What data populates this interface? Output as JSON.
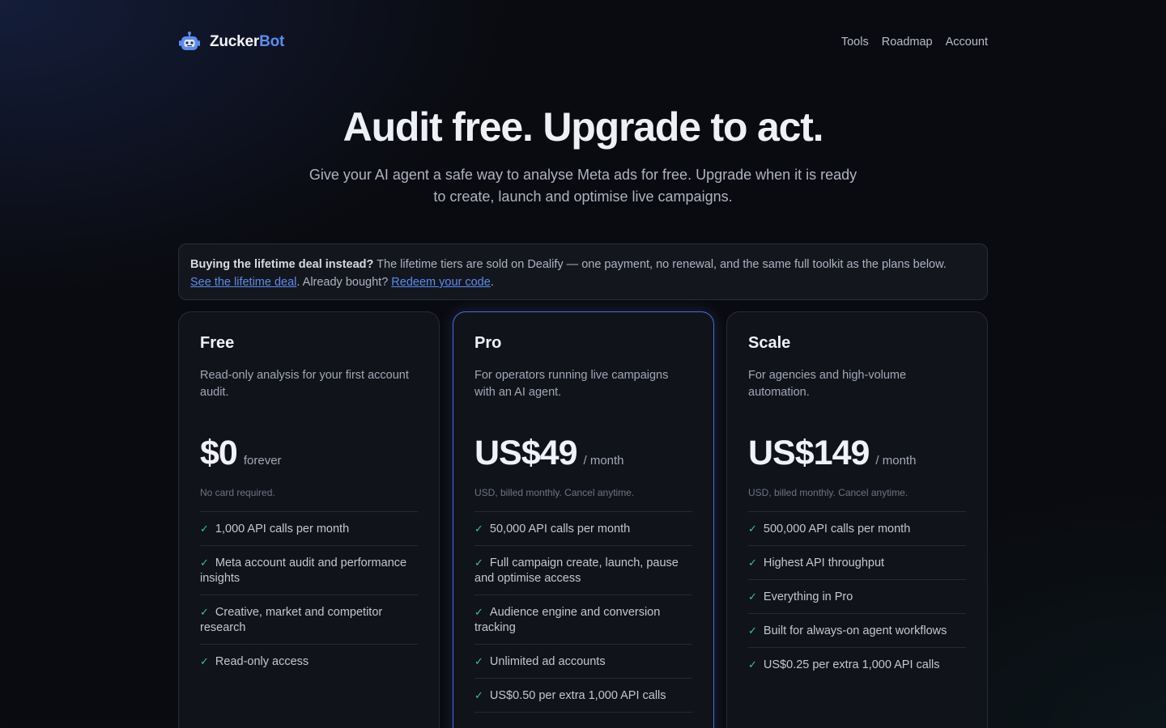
{
  "brand": {
    "name_part1": "Zucker",
    "name_part2": "Bot",
    "accent_color": "#5b8def",
    "icon": "robot-icon"
  },
  "nav": {
    "links": [
      "Tools",
      "Roadmap",
      "Account"
    ]
  },
  "hero": {
    "title": "Audit free. Upgrade to act.",
    "subtitle": "Give your AI agent a safe way to analyse Meta ads for free. Upgrade when it is ready to create, launch and optimise live campaigns."
  },
  "notice": {
    "bold": "Buying the lifetime deal instead?",
    "text": " The lifetime tiers are sold on Dealify — one payment, no renewal, and the same full toolkit as the plans below.",
    "link1": "See the lifetime deal",
    "mid": ". Already bought? ",
    "link2": "Redeem your code",
    "end": "."
  },
  "plans": [
    {
      "name": "Free",
      "description": "Read-only analysis for your first account audit.",
      "price": "$0",
      "period": "forever",
      "note": "No card required.",
      "features": [
        "1,000 API calls per month",
        "Meta account audit and performance insights",
        "Creative, market and competitor research",
        "Read-only access"
      ]
    },
    {
      "name": "Pro",
      "description": "For operators running live campaigns with an AI agent.",
      "price": "US$49",
      "period": "/ month",
      "note": "USD, billed monthly. Cancel anytime.",
      "features": [
        "50,000 API calls per month",
        "Full campaign create, launch, pause and optimise access",
        "Audience engine and conversion tracking",
        "Unlimited ad accounts",
        "US$0.50 per extra 1,000 API calls"
      ]
    },
    {
      "name": "Scale",
      "description": "For agencies and high-volume automation.",
      "price": "US$149",
      "period": "/ month",
      "note": "USD, billed monthly. Cancel anytime.",
      "features": [
        "500,000 API calls per month",
        "Highest API throughput",
        "Everything in Pro",
        "Built for always-on agent workflows",
        "US$0.25 per extra 1,000 API calls"
      ]
    }
  ],
  "check_symbol": "✓",
  "colors": {
    "check": "#34c98a",
    "featured_border": "#4a6cd6",
    "link": "#5b8def"
  }
}
